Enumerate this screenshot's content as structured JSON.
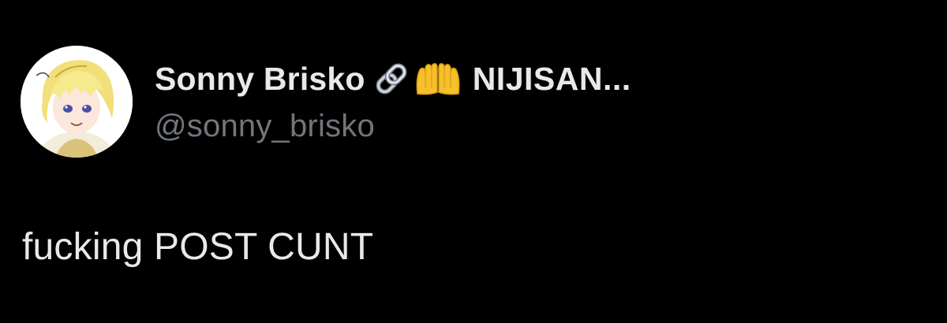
{
  "author": {
    "display_name": "Sonny Brisko",
    "name_suffix": "NIJISAN...",
    "handle": "@sonny_brisko",
    "emojis": [
      "link-icon",
      "palms-up-together-icon"
    ]
  },
  "tweet": {
    "text": "fucking POST CUNT"
  },
  "colors": {
    "background": "#000000",
    "primary_text": "#e7e9ea",
    "secondary_text": "#71767b"
  }
}
